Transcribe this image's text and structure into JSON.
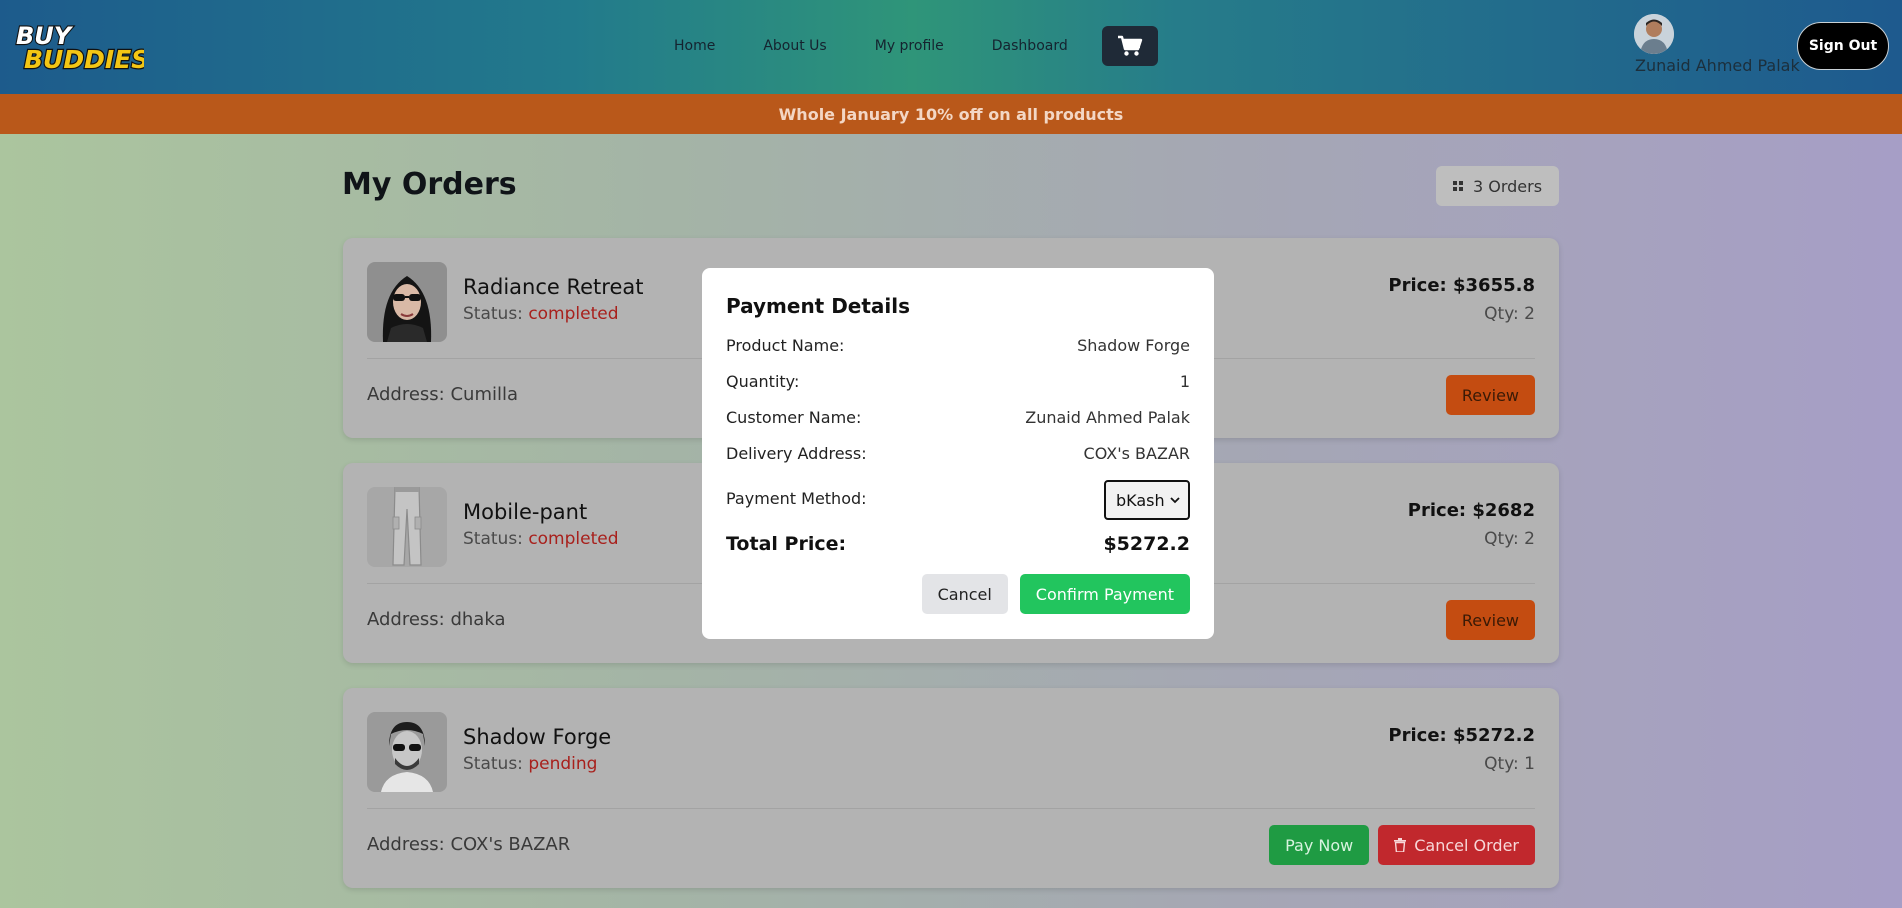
{
  "brand": {
    "line1": "BUY",
    "line2": "BUDDIES"
  },
  "nav": {
    "items": [
      {
        "label": "Home"
      },
      {
        "label": "About Us"
      },
      {
        "label": "My profile"
      },
      {
        "label": "Dashboard"
      }
    ]
  },
  "user": {
    "name": "Zunaid Ahmed Palak",
    "sign_out": "Sign Out"
  },
  "promo": "Whole January 10% off on all products",
  "orders_page": {
    "title": "My Orders",
    "count_label": "3 Orders",
    "orders": [
      {
        "name": "Radiance Retreat",
        "status_label": "Status: ",
        "status": "completed",
        "price": "Price: $3655.8",
        "qty": "Qty: 2",
        "address": "Address: Cumilla",
        "actions": {
          "review": "Review"
        }
      },
      {
        "name": "Mobile-pant",
        "status_label": "Status: ",
        "status": "completed",
        "price": "Price: $2682",
        "qty": "Qty: 2",
        "address": "Address: dhaka",
        "actions": {
          "review": "Review"
        }
      },
      {
        "name": "Shadow Forge",
        "status_label": "Status: ",
        "status": "pending",
        "price": "Price: $5272.2",
        "qty": "Qty: 1",
        "address": "Address: COX's BAZAR",
        "actions": {
          "pay_now": "Pay Now",
          "cancel_order": "Cancel Order"
        }
      }
    ]
  },
  "modal": {
    "title": "Payment Details",
    "rows": [
      {
        "label": "Product Name:",
        "value": "Shadow Forge"
      },
      {
        "label": "Quantity:",
        "value": "1"
      },
      {
        "label": "Customer Name:",
        "value": "Zunaid Ahmed Palak"
      },
      {
        "label": "Delivery Address:",
        "value": "COX's BAZAR"
      }
    ],
    "payment_method_label": "Payment Method:",
    "payment_method_value": "bKash",
    "total_label": "Total Price:",
    "total_value": "$5272.2",
    "cancel": "Cancel",
    "confirm": "Confirm Payment"
  },
  "colors": {
    "status_text": "#a8201c",
    "review_button": "#c44c11",
    "pay_now_button": "#1f9b43",
    "cancel_order_button": "#c1282d",
    "confirm_button": "#22c55e",
    "promo_bar": "#b9581a"
  },
  "icons": {
    "cart": "shopping-cart-icon",
    "orders_count": "grid-icon",
    "cancel_order": "trash-icon",
    "select": "chevron-down-icon"
  }
}
